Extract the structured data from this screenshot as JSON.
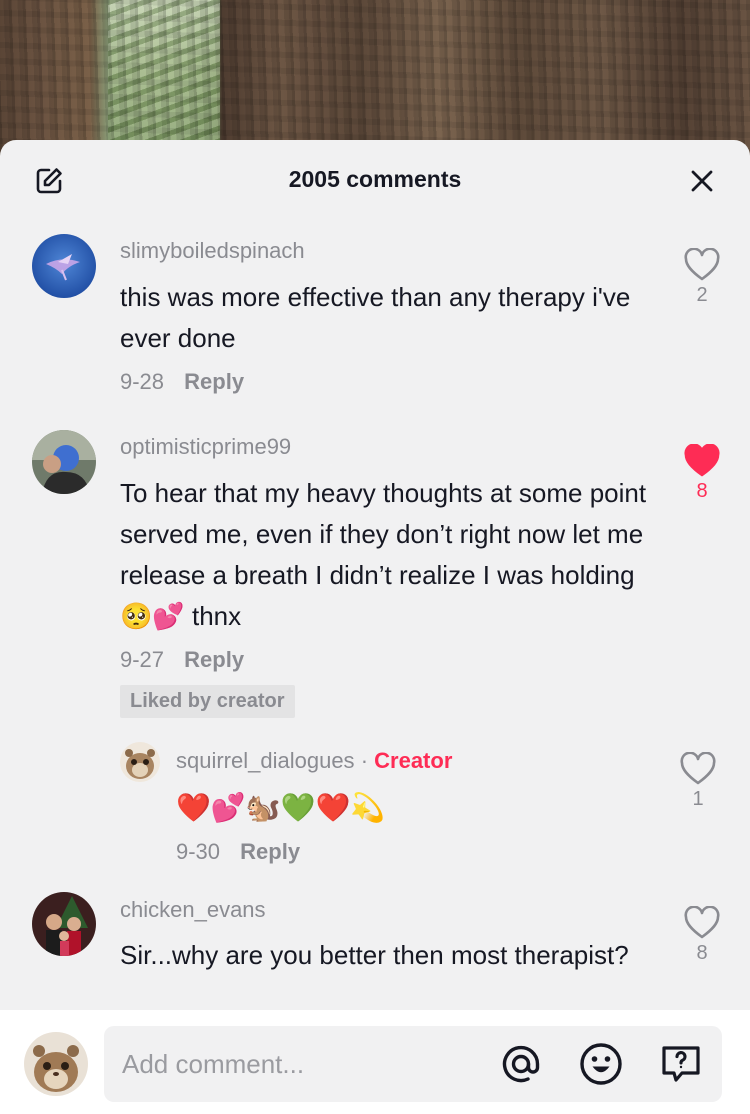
{
  "header": {
    "title": "2005 comments"
  },
  "comments": [
    {
      "username": "slimyboiledspinach",
      "text": "this was more effective than any therapy i've ever done",
      "date": "9-28",
      "reply_label": "Reply",
      "likes": "2",
      "liked": false
    },
    {
      "username": "optimisticprime99",
      "text": "To hear that my heavy thoughts at some point served me, even if they don’t right now let me release a breath I didn’t realize I was holding 🥺💕 thnx",
      "date": "9-27",
      "reply_label": "Reply",
      "likes": "8",
      "liked": true,
      "badge": "Liked by creator",
      "reply": {
        "username": "squirrel_dialogues",
        "separator": "·",
        "creator_label": "Creator",
        "text": "❤️💕🐿️💚❤️💫",
        "date": "9-30",
        "reply_label": "Reply",
        "likes": "1",
        "liked": false
      }
    },
    {
      "username": "chicken_evans",
      "text": "Sir...why are you better then most therapist?",
      "likes": "8",
      "liked": false
    }
  ],
  "input": {
    "placeholder": "Add comment..."
  },
  "icons": {
    "edit": "edit-icon",
    "close": "close-icon",
    "heart": "heart-icon",
    "mention": "at-icon",
    "emoji": "emoji-icon",
    "question": "question-icon"
  },
  "colors": {
    "accent": "#fe2c55",
    "sheet": "#f1f1f2",
    "muted": "#8a8b91",
    "text": "#161823"
  }
}
